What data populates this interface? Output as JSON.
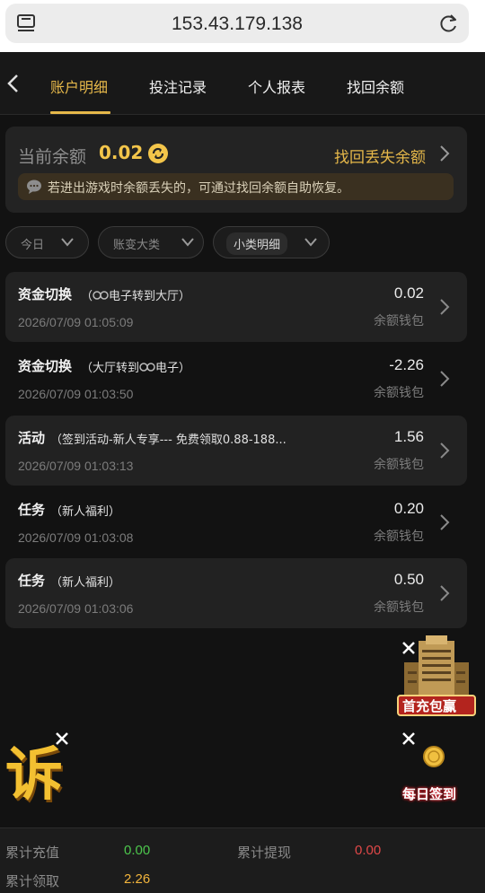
{
  "browser": {
    "url": "153.43.179.138"
  },
  "nav": {
    "tabs": [
      {
        "label": "账户明细",
        "active": true
      },
      {
        "label": "投注记录",
        "active": false
      },
      {
        "label": "个人报表",
        "active": false
      },
      {
        "label": "找回余额",
        "active": false
      }
    ]
  },
  "balance": {
    "label": "当前余额",
    "value": "0.02",
    "recover_link": "找回丢失余额",
    "notice": "若进出游戏时余额丢失的，可通过找回余额自助恢复。"
  },
  "filters": [
    {
      "label": "今日"
    },
    {
      "label": "账变大类"
    },
    {
      "label": "小类明细"
    }
  ],
  "records": [
    {
      "title": "资金切换",
      "sub_prefix": "（",
      "sub_suffix": "电子转到大厅）",
      "sub_icon": "pg-logo-icon",
      "date": "2026/07/09 01:05:09",
      "amount": "0.02",
      "wallet": "余额钱包"
    },
    {
      "title": "资金切换",
      "sub_prefix": "（大厅转到",
      "sub_suffix": "电子）",
      "sub_icon": "pg-logo-icon",
      "date": "2026/07/09 01:03:50",
      "amount": "-2.26",
      "wallet": "余额钱包"
    },
    {
      "title": "活动",
      "sub_prefix": "（签到活动-新人专享--- 免费领取0.88-188...",
      "sub_suffix": "",
      "sub_icon": "",
      "date": "2026/07/09 01:03:13",
      "amount": "1.56",
      "wallet": "余额钱包"
    },
    {
      "title": "任务",
      "sub_prefix": "（新人福利）",
      "sub_suffix": "",
      "sub_icon": "",
      "date": "2026/07/09 01:03:08",
      "amount": "0.20",
      "wallet": "余额钱包"
    },
    {
      "title": "任务",
      "sub_prefix": "（新人福利）",
      "sub_suffix": "",
      "sub_icon": "",
      "date": "2026/07/09 01:03:06",
      "amount": "0.50",
      "wallet": "余额钱包"
    }
  ],
  "promos": {
    "first_deposit": "首充包赢",
    "daily_checkin": "每日签到",
    "complaint_char": "诉"
  },
  "footer": {
    "deposit_label": "累计充值",
    "deposit_value": "0.00",
    "withdraw_label": "累计提现",
    "withdraw_value": "0.00",
    "claim_label": "累计领取",
    "claim_value": "2.26"
  },
  "colors": {
    "accent": "#e6b84a",
    "green": "#4cc64c",
    "red": "#e04848",
    "orange": "#f3b53c"
  }
}
